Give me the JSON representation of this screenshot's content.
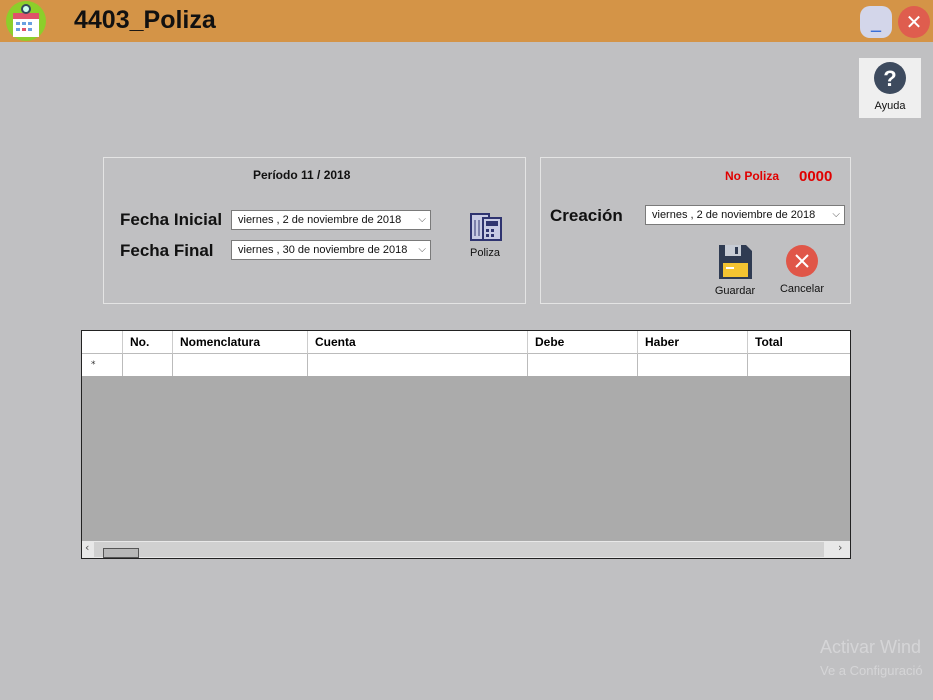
{
  "window": {
    "title": "4403_Poliza",
    "minimize_label": "_",
    "close_label": "✕"
  },
  "help": {
    "label": "Ayuda",
    "icon": "question-icon"
  },
  "periodo": {
    "label": "Período 11 / 2018"
  },
  "fecha_inicial": {
    "label": "Fecha Inicial",
    "value": "viernes ,  2 de noviembre de 2018"
  },
  "fecha_final": {
    "label": "Fecha Final",
    "value": "viernes , 30 de noviembre de 2018"
  },
  "poliza_button": {
    "label": "Poliza"
  },
  "no_poliza": {
    "label": "No Poliza",
    "value": "0000",
    "color": "#e00000"
  },
  "creacion": {
    "label": "Creación",
    "value": "viernes ,  2 de noviembre de 2018"
  },
  "guardar": {
    "label": "Guardar"
  },
  "cancelar": {
    "label": "Cancelar"
  },
  "grid": {
    "columns": [
      "No.",
      "Nomenclatura",
      "Cuenta",
      "Debe",
      "Haber",
      "Total"
    ],
    "new_row_marker": "*"
  },
  "watermark": {
    "line1": "Activar Wind",
    "line2": "Ve a Configuració"
  }
}
